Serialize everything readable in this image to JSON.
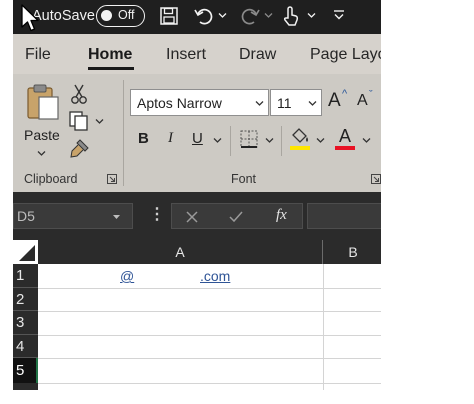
{
  "title_bar": {
    "autosave_label": "AutoSave",
    "autosave_toggle": "Off"
  },
  "tabs": [
    "File",
    "Home",
    "Insert",
    "Draw",
    "Page Layo"
  ],
  "ribbon": {
    "clipboard": {
      "paste_label": "Paste",
      "group_label": "Clipboard"
    },
    "font": {
      "font_name": "Aptos Narrow",
      "font_size": "11",
      "grow_label": "A",
      "shrink_label": "A",
      "bold_label": "B",
      "italic_label": "I",
      "underline_label": "U",
      "font_color_label": "A",
      "group_label": "Font",
      "highlight_color": "#ffe600",
      "font_color": "#e81123"
    }
  },
  "formula_bar": {
    "name_box": "D5",
    "fx_label": "fx"
  },
  "grid": {
    "columns": [
      "A",
      "B"
    ],
    "rows": [
      "1",
      "2",
      "3",
      "4",
      "5"
    ],
    "cells": {
      "A1_at": "@",
      "A1_domain": ".com"
    }
  }
}
